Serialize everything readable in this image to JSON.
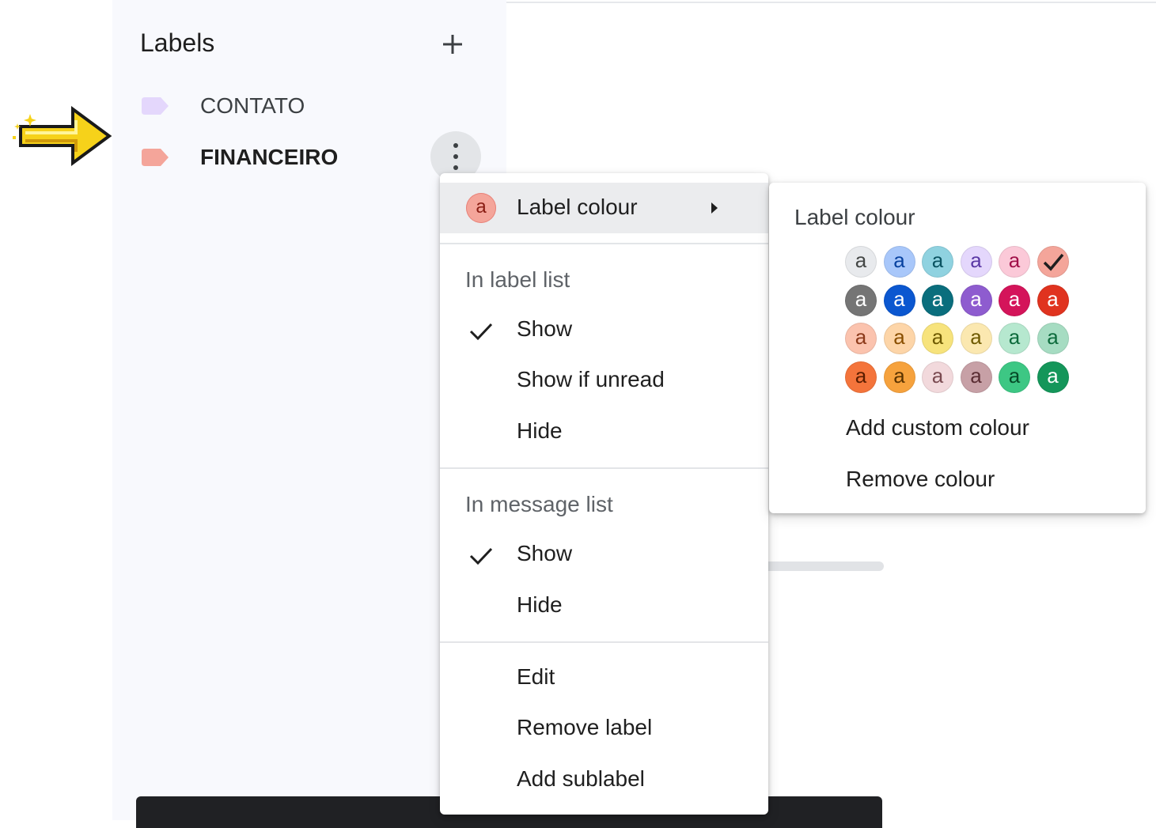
{
  "sidebar": {
    "title": "Labels",
    "labels": [
      {
        "name": "CONTATO",
        "color": "#e4d7fc"
      },
      {
        "name": "FINANCEIRO",
        "color": "#f4a59a"
      }
    ]
  },
  "menu": {
    "label_colour": {
      "label": "Label colour",
      "swatch_letter": "a"
    },
    "label_list": {
      "heading": "In label list",
      "show": "Show",
      "show_if_unread": "Show if unread",
      "hide": "Hide"
    },
    "message_list": {
      "heading": "In message list",
      "show": "Show",
      "hide": "Hide"
    },
    "actions": {
      "edit": "Edit",
      "remove_label": "Remove label",
      "add_sublabel": "Add sublabel"
    }
  },
  "colour_panel": {
    "title": "Label colour",
    "letter": "a",
    "selected_index": 5,
    "swatches": [
      {
        "bg": "#e8eaed",
        "fg": "#444746"
      },
      {
        "bg": "#a8c7fa",
        "fg": "#0842a0"
      },
      {
        "bg": "#8fd2e0",
        "fg": "#0a5361"
      },
      {
        "bg": "#e4d7fc",
        "fg": "#5a38a5"
      },
      {
        "bg": "#fbc9d8",
        "fg": "#a1114a"
      },
      {
        "bg": "#f4a59a",
        "fg": "#8a1d13"
      },
      {
        "bg": "#757575",
        "fg": "#ffffff"
      },
      {
        "bg": "#0b57d0",
        "fg": "#ffffff"
      },
      {
        "bg": "#0a6e7d",
        "fg": "#ffffff"
      },
      {
        "bg": "#8e5ccf",
        "fg": "#ffffff"
      },
      {
        "bg": "#d4145a",
        "fg": "#ffffff"
      },
      {
        "bg": "#e0331f",
        "fg": "#ffffff"
      },
      {
        "bg": "#fbc3ae",
        "fg": "#8c3a1a"
      },
      {
        "bg": "#fdd5a8",
        "fg": "#8a4f00"
      },
      {
        "bg": "#f7e37c",
        "fg": "#6e5a00"
      },
      {
        "bg": "#fbe8b0",
        "fg": "#6e5a00"
      },
      {
        "bg": "#b6e8cf",
        "fg": "#0d6b3c"
      },
      {
        "bg": "#a6dcc2",
        "fg": "#0d6b3c"
      },
      {
        "bg": "#f4743b",
        "fg": "#5a1d00"
      },
      {
        "bg": "#f6a23d",
        "fg": "#5a3300"
      },
      {
        "bg": "#f2d9dc",
        "fg": "#7a4a50"
      },
      {
        "bg": "#c7a0a6",
        "fg": "#5a2d33"
      },
      {
        "bg": "#3dc784",
        "fg": "#064a28"
      },
      {
        "bg": "#14965a",
        "fg": "#ffffff"
      }
    ],
    "add_custom": "Add custom colour",
    "remove": "Remove colour"
  }
}
